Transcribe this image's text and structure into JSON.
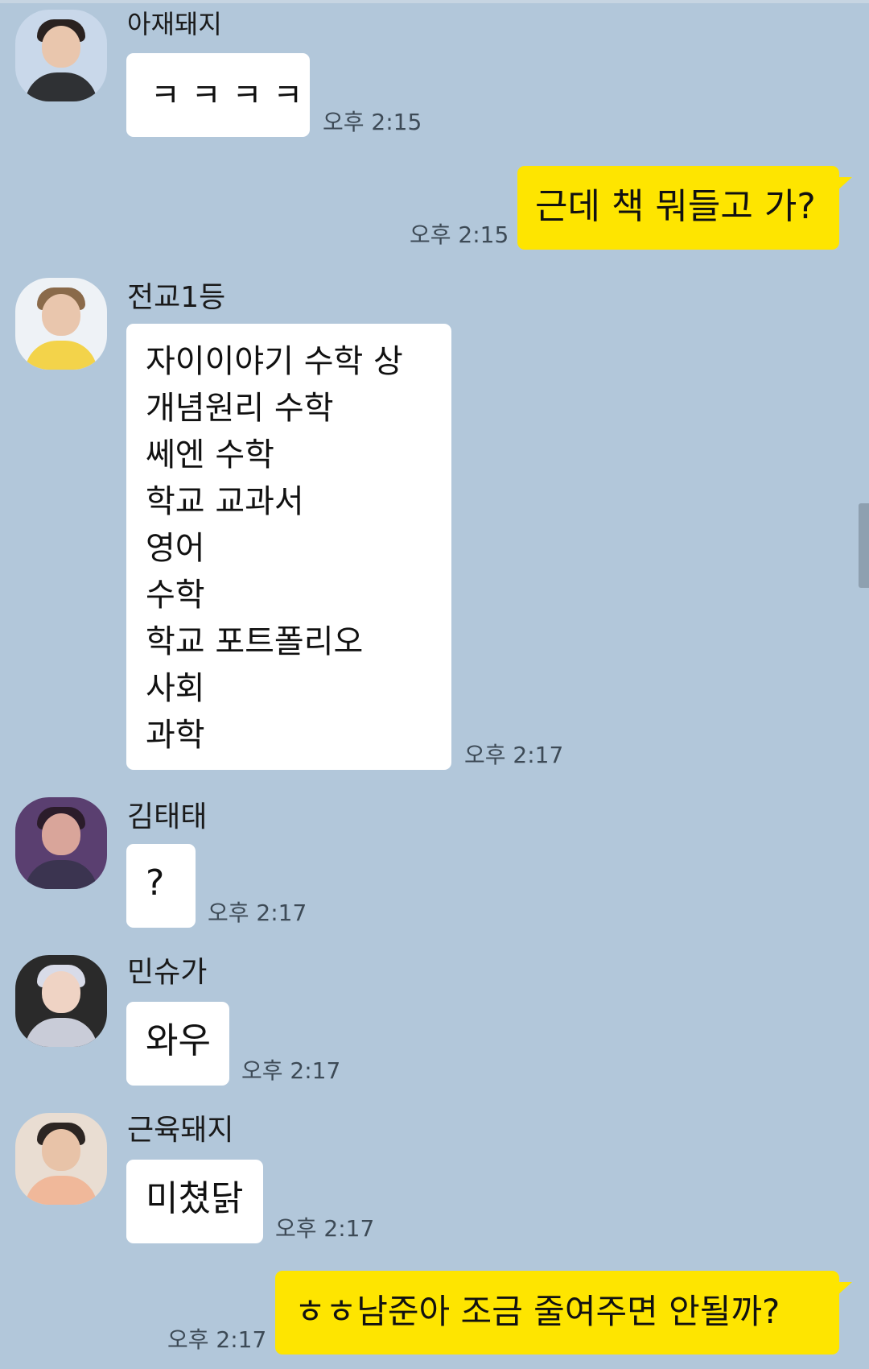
{
  "messages": [
    {
      "sender": "아재돼지",
      "text": [
        "ㅋㅋㅋㅋ"
      ],
      "time": "오후 2:15",
      "from_me": false
    },
    {
      "sender": "",
      "text": [
        "근데 책 뭐들고 가?"
      ],
      "time": "오후 2:15",
      "from_me": true
    },
    {
      "sender": "전교1등",
      "text": [
        "자이이야기 수학 상",
        "개념원리 수학",
        "쎄엔 수학",
        "학교 교과서",
        "영어",
        "수학",
        "학교 포트폴리오",
        "사회",
        "과학"
      ],
      "time": "오후 2:17",
      "from_me": false
    },
    {
      "sender": "김태태",
      "text": [
        "?"
      ],
      "time": "오후 2:17",
      "from_me": false
    },
    {
      "sender": "민슈가",
      "text": [
        "와우"
      ],
      "time": "오후 2:17",
      "from_me": false
    },
    {
      "sender": "근육돼지",
      "text": [
        "미쳤닭"
      ],
      "time": "오후 2:17",
      "from_me": false
    },
    {
      "sender": "",
      "text": [
        "ㅎㅎ남준아 조금 줄여주면 안될까?"
      ],
      "time": "오후 2:17",
      "from_me": true
    }
  ],
  "colors": {
    "background": "#b2c7da",
    "my_bubble": "#fee500",
    "their_bubble": "#ffffff"
  }
}
